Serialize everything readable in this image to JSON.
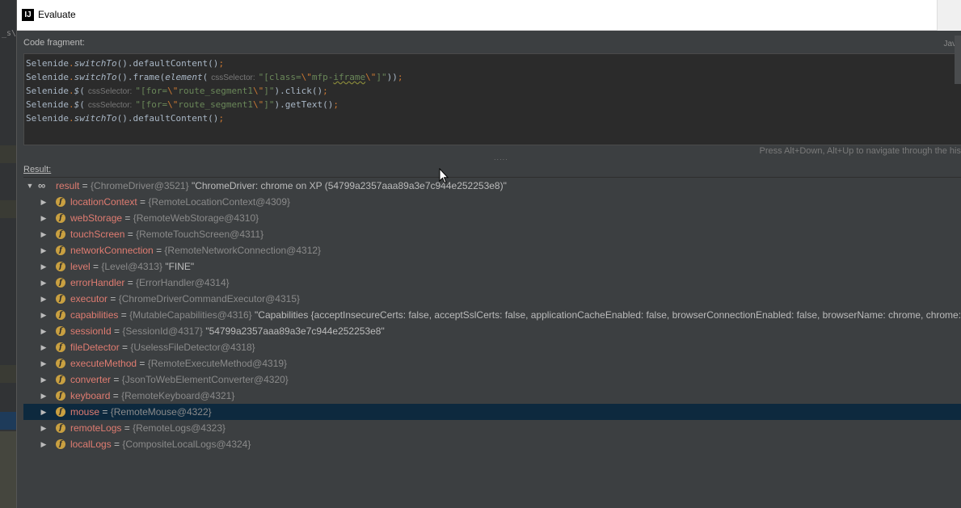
{
  "background": {
    "left_text": "_s\\"
  },
  "dialog": {
    "title": "Evaluate",
    "app_icon": "IJ",
    "code_fragment_label": "Code fragment:",
    "language_label": "Jav",
    "code_lines": [
      {
        "seg": [
          {
            "t": "Selenide",
            "c": ""
          },
          {
            "t": ".",
            "c": "c-dot"
          },
          {
            "t": "switchTo",
            "c": "c-ital"
          },
          {
            "t": "().defaultContent()",
            "c": ""
          },
          {
            "t": ";",
            "c": "c-semi"
          }
        ]
      },
      {
        "seg": [
          {
            "t": "Selenide",
            "c": ""
          },
          {
            "t": ".",
            "c": "c-dot"
          },
          {
            "t": "switchTo",
            "c": "c-ital"
          },
          {
            "t": "().frame(",
            "c": ""
          },
          {
            "t": "element",
            "c": "c-ital"
          },
          {
            "t": "(",
            "c": ""
          },
          {
            "t": "cssSelector:",
            "c": "c-hint"
          },
          {
            "t": "\"[class=",
            "c": "c-str"
          },
          {
            "t": "\\\"",
            "c": "c-esc"
          },
          {
            "t": "mfp-",
            "c": "c-str"
          },
          {
            "t": "iframe",
            "c": "c-str squiggle"
          },
          {
            "t": "\\\"",
            "c": "c-esc"
          },
          {
            "t": "]\"",
            "c": "c-str"
          },
          {
            "t": "))",
            "c": ""
          },
          {
            "t": ";",
            "c": "c-semi"
          }
        ]
      },
      {
        "seg": [
          {
            "t": "Selenide",
            "c": ""
          },
          {
            "t": ".",
            "c": "c-dot"
          },
          {
            "t": "$",
            "c": "c-ital"
          },
          {
            "t": "(",
            "c": ""
          },
          {
            "t": "cssSelector:",
            "c": "c-hint"
          },
          {
            "t": "\"[for=",
            "c": "c-str"
          },
          {
            "t": "\\\"",
            "c": "c-esc"
          },
          {
            "t": "route_segment1",
            "c": "c-str"
          },
          {
            "t": "\\\"",
            "c": "c-esc"
          },
          {
            "t": "]\"",
            "c": "c-str"
          },
          {
            "t": ").click()",
            "c": ""
          },
          {
            "t": ";",
            "c": "c-semi"
          }
        ]
      },
      {
        "seg": [
          {
            "t": "Selenide",
            "c": ""
          },
          {
            "t": ".",
            "c": "c-dot"
          },
          {
            "t": "$",
            "c": "c-ital"
          },
          {
            "t": "(",
            "c": ""
          },
          {
            "t": "cssSelector:",
            "c": "c-hint"
          },
          {
            "t": "\"[for=",
            "c": "c-str"
          },
          {
            "t": "\\\"",
            "c": "c-esc"
          },
          {
            "t": "route_segment1",
            "c": "c-str"
          },
          {
            "t": "\\\"",
            "c": "c-esc"
          },
          {
            "t": "]\"",
            "c": "c-str"
          },
          {
            "t": ").getText()",
            "c": ""
          },
          {
            "t": ";",
            "c": "c-semi"
          }
        ]
      },
      {
        "seg": [
          {
            "t": "Selenide",
            "c": ""
          },
          {
            "t": ".",
            "c": "c-dot"
          },
          {
            "t": "switchTo",
            "c": "c-ital"
          },
          {
            "t": "().defaultContent()",
            "c": ""
          },
          {
            "t": ";",
            "c": "c-semi"
          }
        ]
      }
    ],
    "splitter_glyph": ".....",
    "nav_hint": "Press Alt+Down, Alt+Up to navigate through the his",
    "result_label": "Result:"
  },
  "result_tree": [
    {
      "name": "result",
      "type": "{ChromeDriver@3521}",
      "value": "\"ChromeDriver: chrome on XP (54799a2357aaa89a3e7c944e252253e8)\"",
      "root": true,
      "expanded": true
    },
    {
      "name": "locationContext",
      "type": "{RemoteLocationContext@4309}",
      "value": ""
    },
    {
      "name": "webStorage",
      "type": "{RemoteWebStorage@4310}",
      "value": ""
    },
    {
      "name": "touchScreen",
      "type": "{RemoteTouchScreen@4311}",
      "value": ""
    },
    {
      "name": "networkConnection",
      "type": "{RemoteNetworkConnection@4312}",
      "value": ""
    },
    {
      "name": "level",
      "type": "{Level@4313}",
      "value": "\"FINE\""
    },
    {
      "name": "errorHandler",
      "type": "{ErrorHandler@4314}",
      "value": ""
    },
    {
      "name": "executor",
      "type": "{ChromeDriverCommandExecutor@4315}",
      "value": ""
    },
    {
      "name": "capabilities",
      "type": "{MutableCapabilities@4316}",
      "value": "\"Capabilities {acceptInsecureCerts: false, acceptSslCerts: false, applicationCacheEnabled: false, browserConnectionEnabled: false, browserName: chrome, chrome: {",
      "more": "... Vi"
    },
    {
      "name": "sessionId",
      "type": "{SessionId@4317}",
      "value": "\"54799a2357aaa89a3e7c944e252253e8\""
    },
    {
      "name": "fileDetector",
      "type": "{UselessFileDetector@4318}",
      "value": ""
    },
    {
      "name": "executeMethod",
      "type": "{RemoteExecuteMethod@4319}",
      "value": ""
    },
    {
      "name": "converter",
      "type": "{JsonToWebElementConverter@4320}",
      "value": ""
    },
    {
      "name": "keyboard",
      "type": "{RemoteKeyboard@4321}",
      "value": ""
    },
    {
      "name": "mouse",
      "type": "{RemoteMouse@4322}",
      "value": "",
      "selected": true
    },
    {
      "name": "remoteLogs",
      "type": "{RemoteLogs@4323}",
      "value": ""
    },
    {
      "name": "localLogs",
      "type": "{CompositeLocalLogs@4324}",
      "value": ""
    }
  ],
  "icons": {
    "collapse": "triangle-down-icon",
    "expand": "triangle-right-icon",
    "root": "object-infinity-icon",
    "field": "field-f-icon"
  },
  "colors": {
    "field_name": "#e07c71",
    "type_text": "#8a8a8a",
    "selection": "#0d293e",
    "field_icon": "#c9a041"
  }
}
